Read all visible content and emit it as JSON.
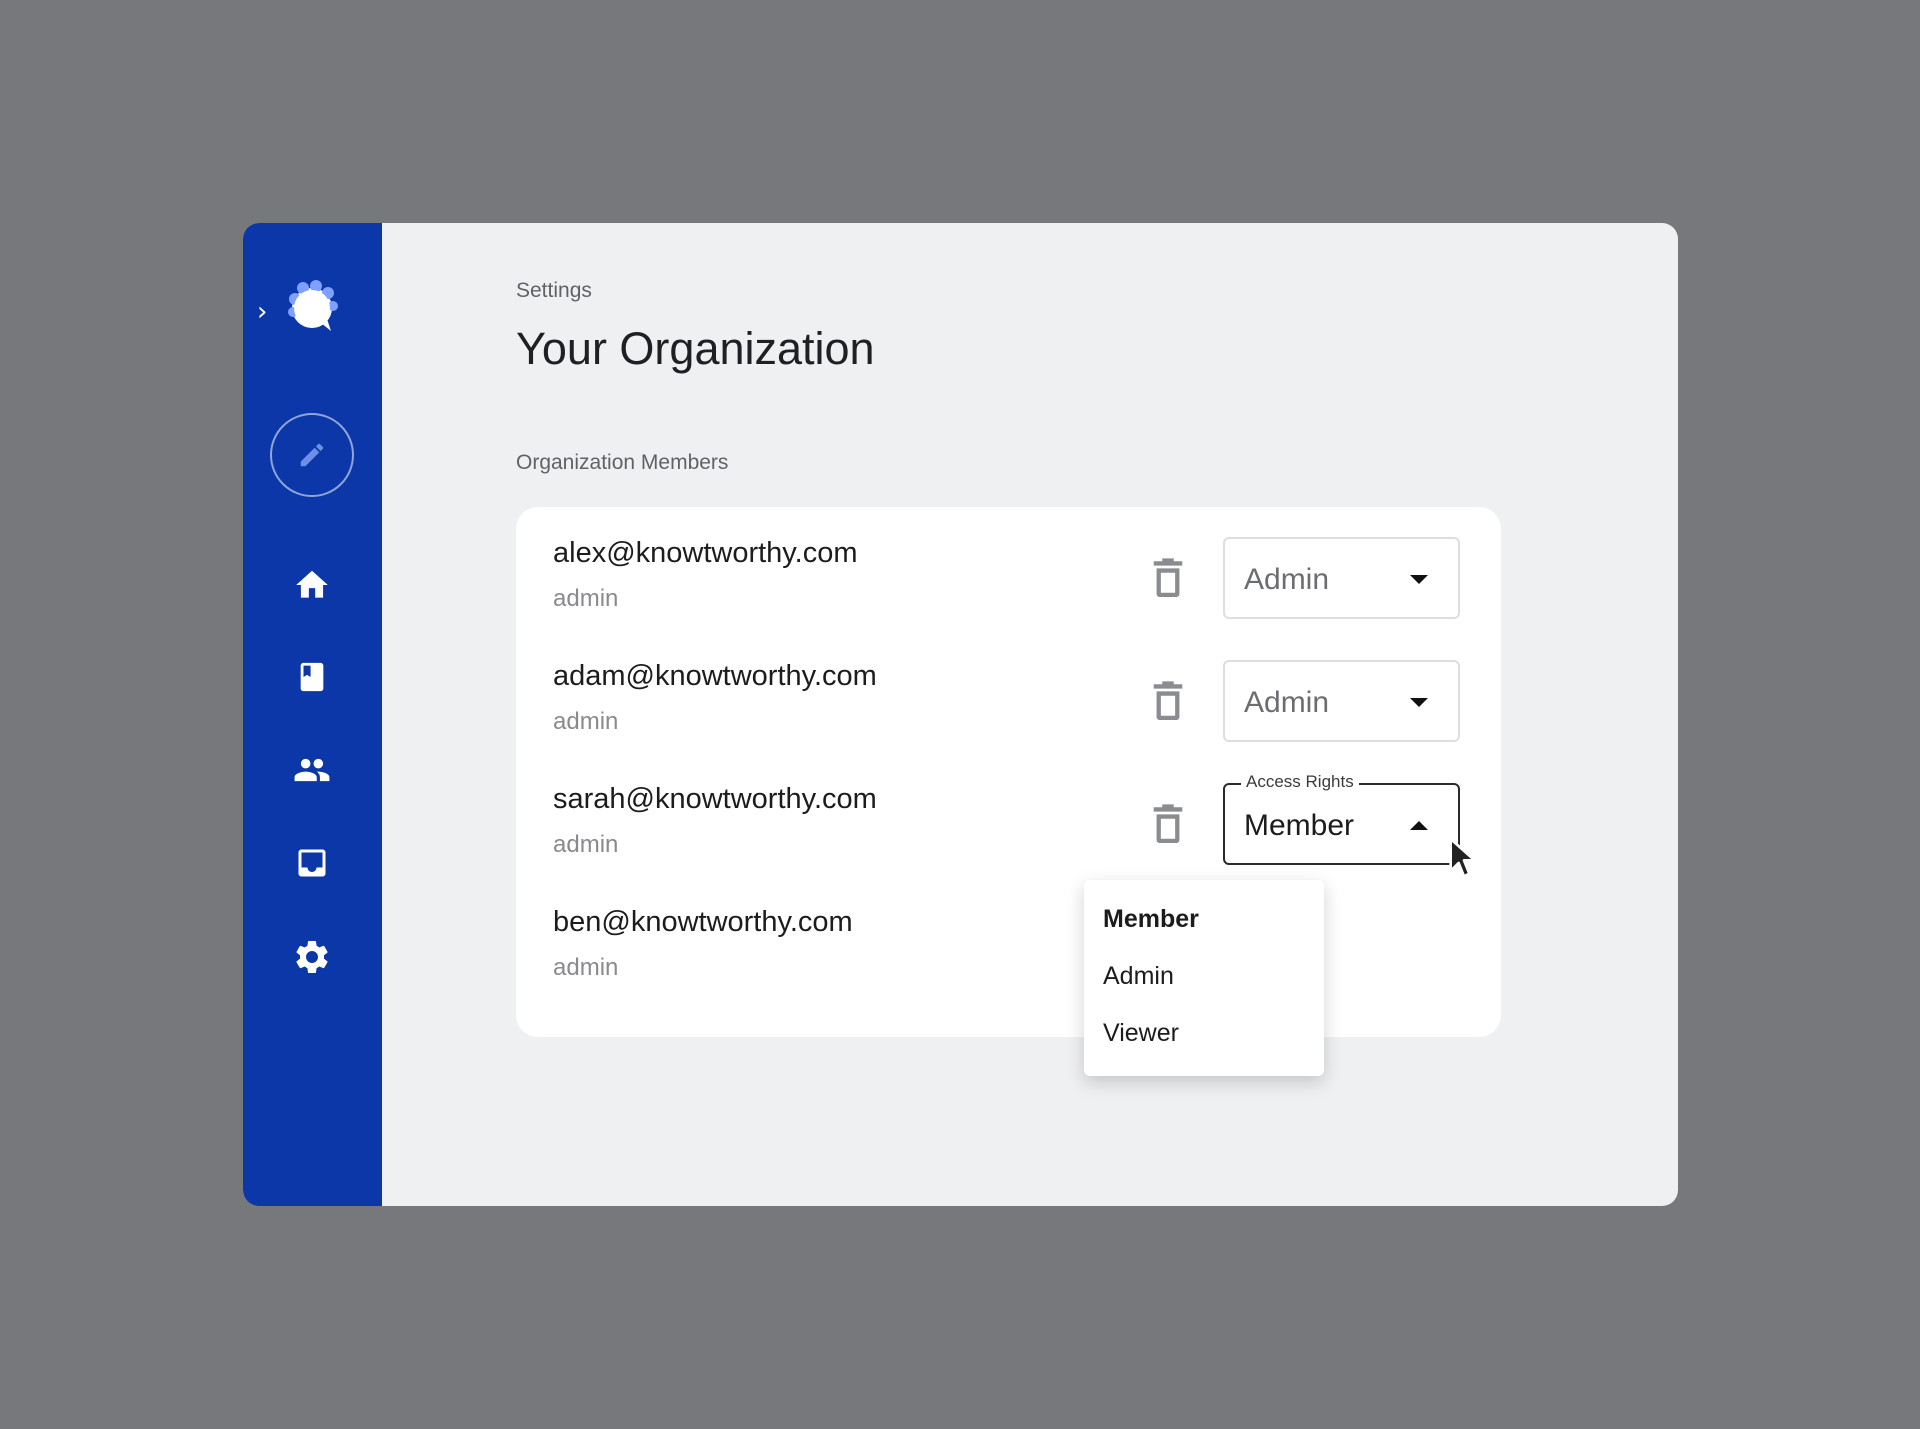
{
  "app": {
    "breadcrumb": "Settings",
    "page_title": "Your Organization",
    "section_title": "Organization Members"
  },
  "colors": {
    "sidebar": "#0b37a9",
    "background": "#77787b",
    "content_bg": "#eff0f2"
  },
  "sidebar": {
    "expand_glyph": "›",
    "items": [
      {
        "icon": "home-icon"
      },
      {
        "icon": "book-icon"
      },
      {
        "icon": "people-icon"
      },
      {
        "icon": "inbox-icon"
      },
      {
        "icon": "gear-icon"
      }
    ]
  },
  "members": [
    {
      "email": "alex@knowtworthy.com",
      "role": "admin",
      "access": "Admin"
    },
    {
      "email": "adam@knowtworthy.com",
      "role": "admin",
      "access": "Admin"
    },
    {
      "email": "sarah@knowtworthy.com",
      "role": "admin",
      "access": "Member",
      "access_label": "Access Rights"
    },
    {
      "email": "ben@knowtworthy.com",
      "role": "admin"
    }
  ],
  "dropdown": {
    "options": [
      "Member",
      "Admin",
      "Viewer"
    ],
    "selected": "Member"
  }
}
